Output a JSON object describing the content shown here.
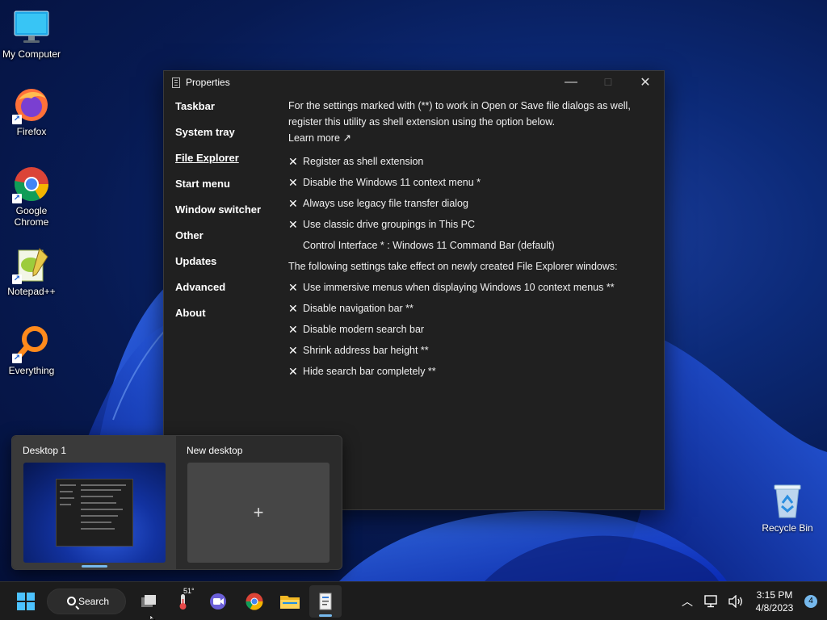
{
  "desktop": {
    "icons": [
      {
        "label": "My Computer",
        "icon": "monitor-icon"
      },
      {
        "label": "Firefox",
        "icon": "firefox-icon"
      },
      {
        "label": "Google Chrome",
        "icon": "chrome-icon"
      },
      {
        "label": "Notepad++",
        "icon": "notepadpp-icon"
      },
      {
        "label": "Everything",
        "icon": "everything-icon"
      },
      {
        "label": "Recycle Bin",
        "icon": "recycle-bin-icon"
      }
    ]
  },
  "window": {
    "title": "Properties",
    "minimize_glyph": "—",
    "maximize_glyph": "☐",
    "close_glyph": "✕",
    "nav": [
      {
        "label": "Taskbar",
        "active": false
      },
      {
        "label": "System tray",
        "active": false
      },
      {
        "label": "File Explorer",
        "active": true
      },
      {
        "label": "Start menu",
        "active": false
      },
      {
        "label": "Window switcher",
        "active": false
      },
      {
        "label": "Other",
        "active": false
      },
      {
        "label": "Updates",
        "active": false
      },
      {
        "label": "Advanced",
        "active": false
      },
      {
        "label": "About",
        "active": false
      }
    ],
    "intro": "For the settings marked with (**) to work in Open or Save file dialogs as well, register this utility as shell extension using the option below.",
    "learn_more": "Learn more ↗",
    "options_group1": [
      {
        "label": "Register as shell extension",
        "checked": false
      },
      {
        "label": "Disable the Windows 11 context menu *",
        "checked": false
      },
      {
        "label": "Always use legacy file transfer dialog",
        "checked": false
      },
      {
        "label": "Use classic drive groupings in This PC",
        "checked": false
      }
    ],
    "control_interface": "Control Interface * : Windows 11 Command Bar (default)",
    "section_note": "The following settings take effect on newly created File Explorer windows:",
    "options_group2": [
      {
        "label": "Use immersive menus when displaying Windows 10 context menus **",
        "checked": false
      },
      {
        "label": "Disable navigation bar **",
        "checked": false
      },
      {
        "label": "Disable modern search bar",
        "checked": false
      },
      {
        "label": "Shrink address bar height **",
        "checked": false
      },
      {
        "label": "Hide search bar completely **",
        "checked": false
      }
    ],
    "unchecked_glyph": "✕"
  },
  "taskview": {
    "desktop1_label": "Desktop 1",
    "new_desktop_label": "New desktop",
    "add_glyph": "+"
  },
  "taskbar": {
    "search_label": "Search",
    "weather_temp": "51°",
    "clock_time": "3:15 PM",
    "clock_date": "4/8/2023",
    "notification_count": "4",
    "apps": [
      "start-icon",
      "task-view-icon",
      "weather-icon",
      "meet-icon",
      "chrome-icon",
      "file-explorer-icon",
      "properties-app-icon"
    ],
    "accent": "#76b9ed"
  }
}
